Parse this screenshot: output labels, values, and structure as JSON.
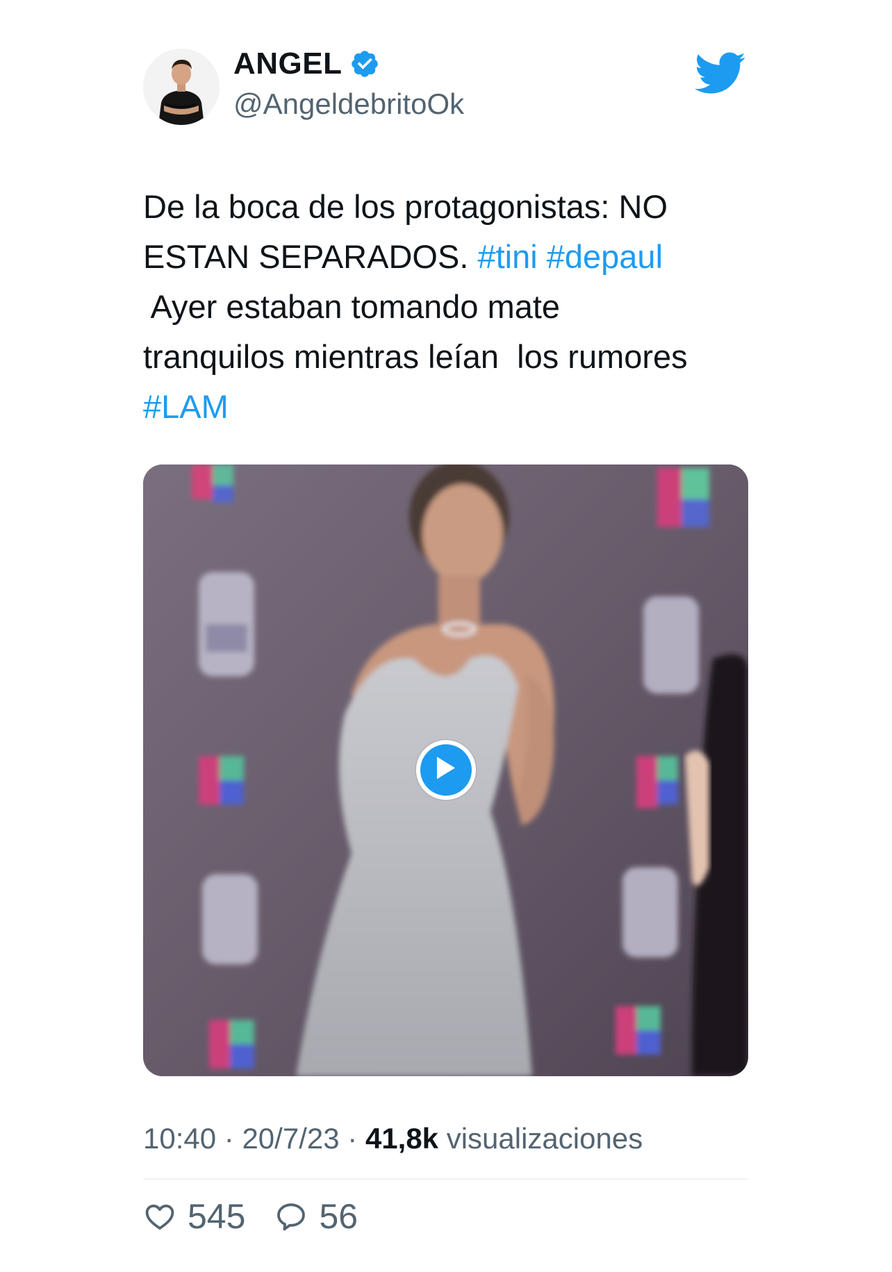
{
  "author": {
    "display_name": "ANGEL",
    "handle": "@AngeldebritoOk",
    "verified": true,
    "avatar": "avatar-photo",
    "verified_icon": "verified-badge-icon"
  },
  "platform_icon": "twitter-bird-icon",
  "tweet": {
    "line1": "De la boca de los protagonistas: NO",
    "line2_text": "ESTAN SEPARADOS. ",
    "hashtag_tini": "#tini",
    "hashtag_depaul": "#depaul",
    "line3": " Ayer estaban tomando mate",
    "line4": "tranquilos mientras leían  los rumores",
    "hashtag_lam": "#LAM"
  },
  "media": {
    "type": "video",
    "play_icon": "play-icon"
  },
  "meta": {
    "time": "10:40",
    "separator": "·",
    "date": "20/7/23",
    "views_count": "41,8k",
    "views_label": "visualizaciones"
  },
  "actions": {
    "likes": "545",
    "replies": "56",
    "like_icon": "heart-icon",
    "reply_icon": "reply-bubble-icon"
  },
  "colors": {
    "accent": "#1d9bf0",
    "text": "#0f1419",
    "secondary_text": "#536471",
    "divider": "#eff3f4"
  }
}
